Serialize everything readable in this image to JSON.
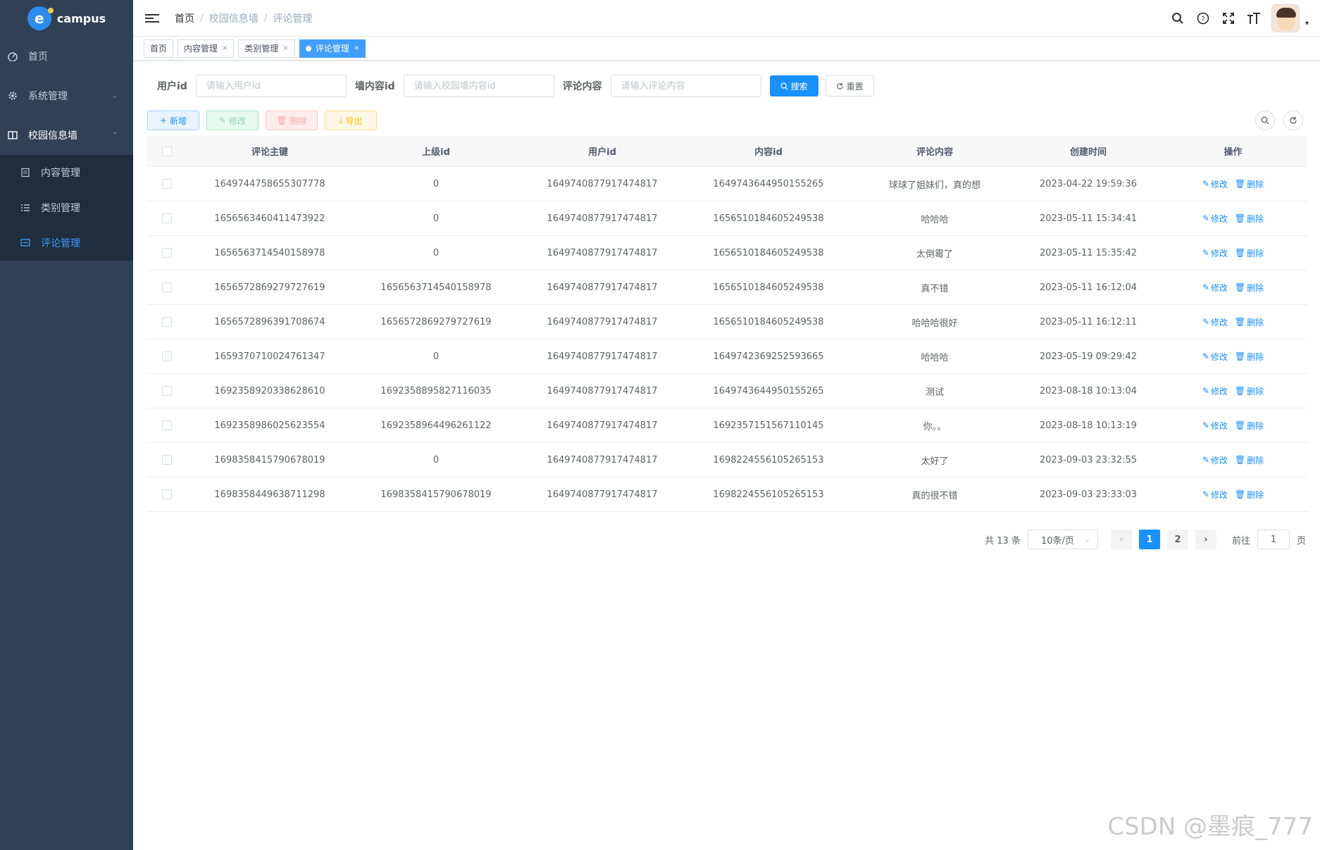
{
  "app": {
    "logo_text": "campus",
    "logo_letter": "e"
  },
  "sidebar": {
    "items": [
      {
        "label": "首页",
        "icon": "dashboard-icon"
      },
      {
        "label": "系统管理",
        "icon": "gear-icon"
      },
      {
        "label": "校园信息墙",
        "icon": "book-icon"
      }
    ],
    "sub_items": [
      {
        "label": "内容管理",
        "icon": "form-icon"
      },
      {
        "label": "类别管理",
        "icon": "list-icon"
      },
      {
        "label": "评论管理",
        "icon": "message-icon"
      }
    ]
  },
  "navbar": {
    "breadcrumb": [
      "首页",
      "校园信息墙",
      "评论管理"
    ],
    "breadcrumb_sep": "/"
  },
  "tags": [
    "首页",
    "内容管理",
    "类别管理",
    "评论管理"
  ],
  "search": {
    "user_label": "用户id",
    "user_placeholder": "请输入用户id",
    "content_id_label": "墙内容id",
    "content_id_placeholder": "请输入校园墙内容id",
    "comment_label": "评论内容",
    "comment_placeholder": "请输入评论内容",
    "search_btn": "搜索",
    "reset_btn": "重置"
  },
  "toolbar": {
    "add": "新增",
    "edit": "修改",
    "delete": "删除",
    "export": "导出"
  },
  "table": {
    "headers": [
      "评论主键",
      "上级id",
      "用户id",
      "内容id",
      "评论内容",
      "创建时间",
      "操作"
    ],
    "op_edit": "修改",
    "op_delete": "删除",
    "rows": [
      [
        "1649744758655307778",
        "0",
        "1649740877917474817",
        "1649743644950155265",
        "球球了姐妹们，真的想",
        "2023-04-22 19:59:36"
      ],
      [
        "1656563460411473922",
        "0",
        "1649740877917474817",
        "1656510184605249538",
        "哈哈哈",
        "2023-05-11 15:34:41"
      ],
      [
        "1656563714540158978",
        "0",
        "1649740877917474817",
        "1656510184605249538",
        "太倒霉了",
        "2023-05-11 15:35:42"
      ],
      [
        "1656572869279727619",
        "1656563714540158978",
        "1649740877917474817",
        "1656510184605249538",
        "真不错",
        "2023-05-11 16:12:04"
      ],
      [
        "1656572896391708674",
        "1656572869279727619",
        "1649740877917474817",
        "1656510184605249538",
        "哈哈哈很好",
        "2023-05-11 16:12:11"
      ],
      [
        "1659370710024761347",
        "0",
        "1649740877917474817",
        "1649742369252593665",
        "哈哈哈",
        "2023-05-19 09:29:42"
      ],
      [
        "1692358920338628610",
        "1692358895827116035",
        "1649740877917474817",
        "1649743644950155265",
        "测试",
        "2023-08-18 10:13:04"
      ],
      [
        "1692358986025623554",
        "1692358964496261122",
        "1649740877917474817",
        "1692357151567110145",
        "你。。",
        "2023-08-18 10:13:19"
      ],
      [
        "1698358415790678019",
        "0",
        "1649740877917474817",
        "1698224556105265153",
        "太好了",
        "2023-09-03 23:32:55"
      ],
      [
        "1698358449638711298",
        "1698358415790678019",
        "1649740877917474817",
        "1698224556105265153",
        "真的很不错",
        "2023-09-03 23:33:03"
      ]
    ]
  },
  "pagination": {
    "total_text": "共 13 条",
    "page_size": "10条/页",
    "pages": [
      "1",
      "2"
    ],
    "current": "1",
    "goto_label": "前往",
    "goto_value": "1",
    "page_suffix": "页"
  },
  "watermark": "CSDN @墨痕_777",
  "colors": {
    "sidebar_bg": "#304156",
    "submenu_bg": "#1f2d3d",
    "primary": "#1890ff"
  }
}
